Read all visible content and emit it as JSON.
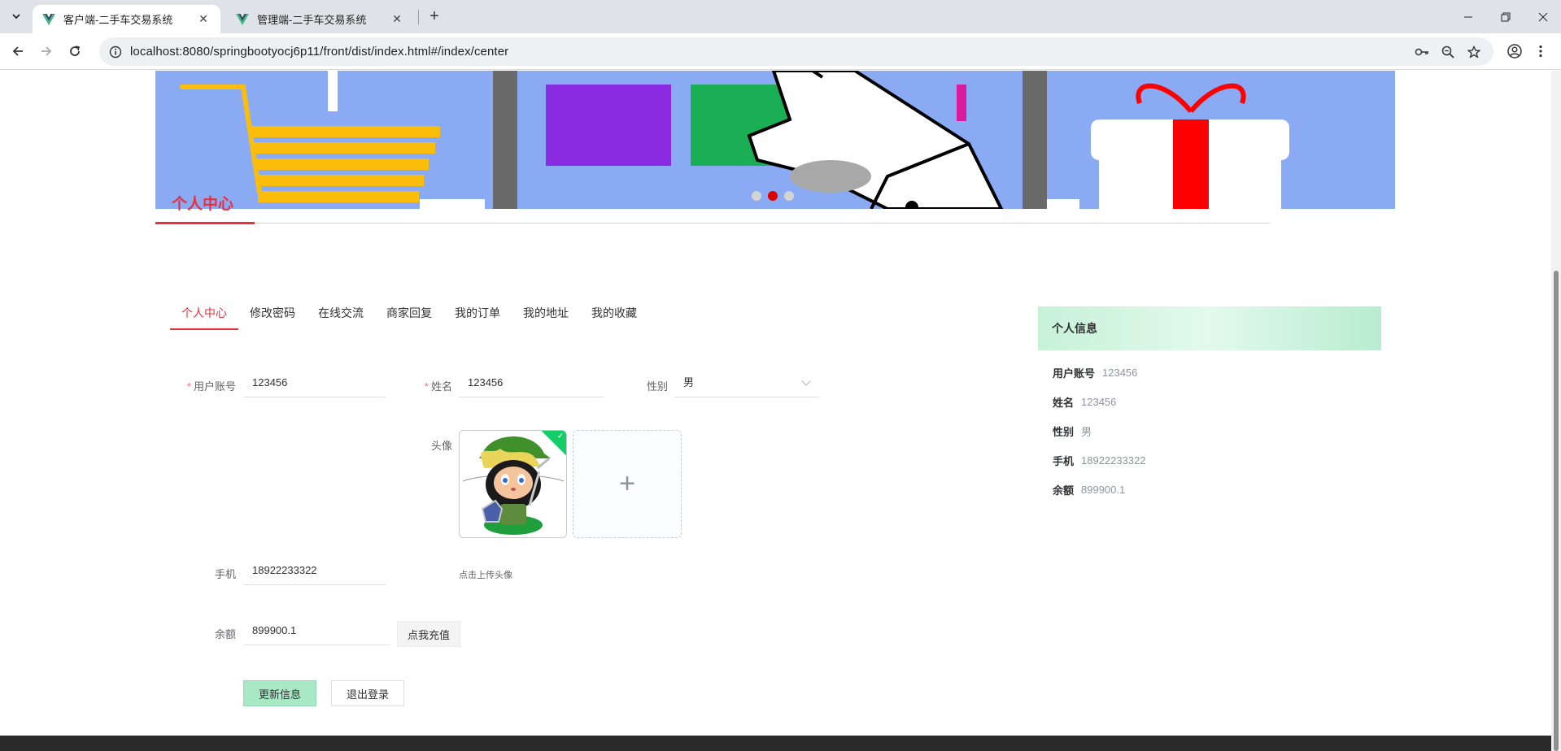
{
  "browser": {
    "tabs": [
      {
        "title": "客户端-二手车交易系统",
        "active": true
      },
      {
        "title": "管理端-二手车交易系统",
        "active": false
      }
    ],
    "url": "localhost:8080/springbootyocj6p11/front/dist/index.html#/index/center"
  },
  "banner": {
    "dots": 3,
    "active_dot": 2
  },
  "section": {
    "title": "个人中心"
  },
  "subtabs": [
    {
      "label": "个人中心",
      "active": true
    },
    {
      "label": "修改密码"
    },
    {
      "label": "在线交流"
    },
    {
      "label": "商家回复"
    },
    {
      "label": "我的订单"
    },
    {
      "label": "我的地址"
    },
    {
      "label": "我的收藏"
    }
  ],
  "form": {
    "account": {
      "label": "用户账号",
      "required_mark": "*",
      "value": "123456"
    },
    "name": {
      "label": "姓名",
      "required_mark": "*",
      "value": "123456"
    },
    "gender": {
      "label": "性别",
      "value": "男"
    },
    "avatar": {
      "label": "头像",
      "upload_tip": "点击上传头像",
      "add_symbol": "+"
    },
    "phone": {
      "label": "手机",
      "value": "18922233322"
    },
    "balance": {
      "label": "余额",
      "value": "899900.1",
      "recharge_button": "点我充值"
    },
    "update_button": "更新信息",
    "logout_button": "退出登录"
  },
  "info_panel": {
    "title": "个人信息",
    "rows": [
      {
        "key": "用户账号",
        "value": "123456"
      },
      {
        "key": "姓名",
        "value": "123456"
      },
      {
        "key": "性别",
        "value": "男"
      },
      {
        "key": "手机",
        "value": "18922233322"
      },
      {
        "key": "余额",
        "value": "899900.1"
      }
    ]
  },
  "colors": {
    "accent": "#e8303e",
    "success_green": "#13ce66",
    "button_green": "#a8e8c4",
    "banner_blue": "#8aaaf4"
  }
}
